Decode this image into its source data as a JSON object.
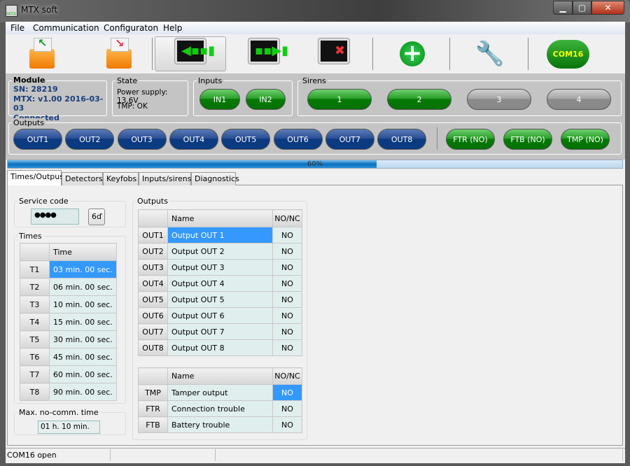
{
  "window": {
    "title": "MTX soft",
    "minimize": "▁",
    "maximize": "▢",
    "close": "✕"
  },
  "menu": [
    "File",
    "Communication",
    "Configuraton",
    "Help"
  ],
  "toolbar": {
    "com_port": "COM16",
    "icons": [
      "open-file-icon",
      "save-file-icon",
      "read-from-device-icon",
      "write-to-device-icon",
      "disconnect-icon",
      "add-icon",
      "settings-wrench-icon"
    ]
  },
  "module": {
    "label": "Module",
    "sn": "SN:  28219",
    "version": "MTX: v1.00 2016-03-03",
    "status": "Connected"
  },
  "state": {
    "label": "State",
    "power": "Power supply: 13,6V",
    "tmp": "TMP: OK"
  },
  "inputs": {
    "label": "Inputs",
    "items": [
      "IN1",
      "IN2"
    ]
  },
  "sirens": {
    "label": "Sirens",
    "items": [
      {
        "label": "1",
        "active": true
      },
      {
        "label": "2",
        "active": true
      },
      {
        "label": "3",
        "active": false
      },
      {
        "label": "4",
        "active": false
      }
    ]
  },
  "outputs_bar": {
    "label": "Outputs",
    "items": [
      "OUT1",
      "OUT2",
      "OUT3",
      "OUT4",
      "OUT5",
      "OUT6",
      "OUT7",
      "OUT8"
    ],
    "status": [
      "FTR (NO)",
      "FTB (NO)",
      "TMP (NO)"
    ]
  },
  "progress": {
    "value": 60,
    "text": "60%"
  },
  "tabs": [
    "Times/Outpus",
    "Detectors",
    "Keyfobs",
    "Inputs/sirens",
    "Diagnostics"
  ],
  "service_code": {
    "label": "Service code",
    "value": "●●●●",
    "reveal_icon": "glasses-icon",
    "reveal_glyph": "6ď"
  },
  "times": {
    "label": "Times",
    "header": "Time",
    "rows": [
      [
        "T1",
        "03 min. 00 sec."
      ],
      [
        "T2",
        "06 min. 00 sec."
      ],
      [
        "T3",
        "10 min. 00 sec."
      ],
      [
        "T4",
        "15 min. 00 sec."
      ],
      [
        "T5",
        "30 min. 00 sec."
      ],
      [
        "T6",
        "45 min. 00 sec."
      ],
      [
        "T7",
        "60 min. 00 sec."
      ],
      [
        "T8",
        "90 min. 00 sec."
      ]
    ]
  },
  "max_nocomm": {
    "label": "Max. no-comm. time",
    "value": "01 h. 10 min."
  },
  "outputs_table": {
    "label": "Outputs",
    "headers": [
      "Name",
      "NO/NC"
    ],
    "rows": [
      [
        "OUT1",
        "Output OUT 1",
        "NO"
      ],
      [
        "OUT2",
        "Output OUT 2",
        "NO"
      ],
      [
        "OUT3",
        "Output OUT 3",
        "NO"
      ],
      [
        "OUT4",
        "Output OUT 4",
        "NO"
      ],
      [
        "OUT5",
        "Output OUT 5",
        "NO"
      ],
      [
        "OUT6",
        "Output OUT 6",
        "NO"
      ],
      [
        "OUT7",
        "Output OUT 7",
        "NO"
      ],
      [
        "OUT8",
        "Output OUT 8",
        "NO"
      ]
    ]
  },
  "special_table": {
    "headers": [
      "Name",
      "NO/NC"
    ],
    "rows": [
      [
        "TMP",
        "Tamper output",
        "NO"
      ],
      [
        "FTR",
        "Connection trouble",
        "NO"
      ],
      [
        "FTB",
        "Battery trouble",
        "NO"
      ]
    ]
  },
  "statusbar": [
    "COM16 open",
    "",
    ""
  ]
}
